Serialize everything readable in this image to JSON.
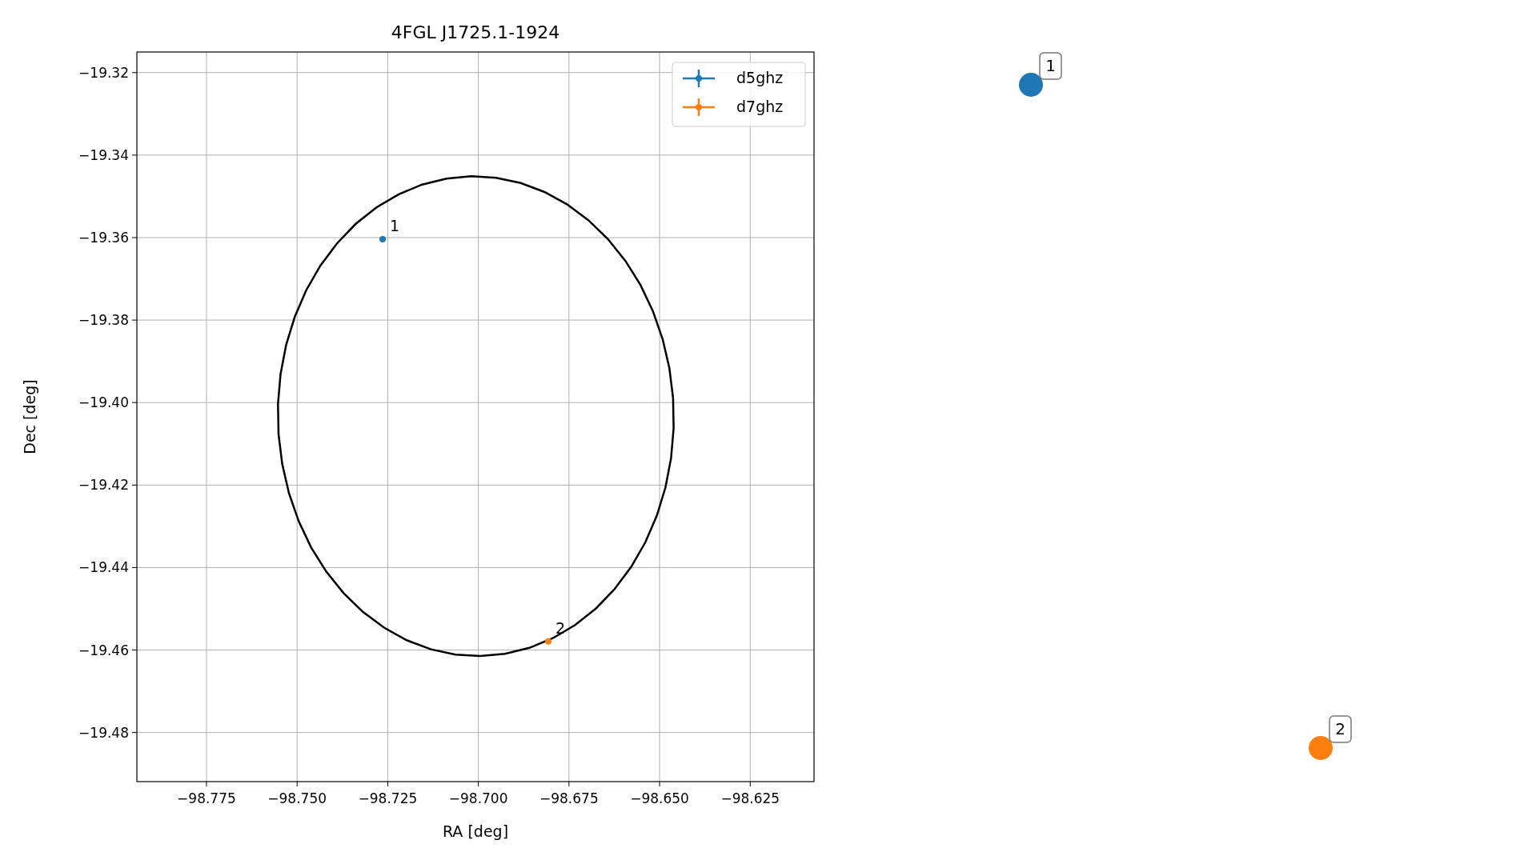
{
  "figure": {
    "chart_data": {
      "type": "scatter",
      "title": "4FGL J1725.1-1924",
      "xlabel": "RA [deg]",
      "ylabel": "Dec [deg]",
      "xlim": [
        -98.7942,
        -98.6074
      ],
      "ylim": [
        -19.4919,
        -19.315
      ],
      "xticks": [
        {
          "value": -98.775,
          "label": "−98.775"
        },
        {
          "value": -98.75,
          "label": "−98.750"
        },
        {
          "value": -98.725,
          "label": "−98.725"
        },
        {
          "value": -98.7,
          "label": "−98.700"
        },
        {
          "value": -98.675,
          "label": "−98.675"
        },
        {
          "value": -98.65,
          "label": "−98.650"
        },
        {
          "value": -98.625,
          "label": "−98.625"
        }
      ],
      "yticks": [
        {
          "value": -19.32,
          "label": "−19.32"
        },
        {
          "value": -19.34,
          "label": "−19.34"
        },
        {
          "value": -19.36,
          "label": "−19.36"
        },
        {
          "value": -19.38,
          "label": "−19.38"
        },
        {
          "value": -19.4,
          "label": "−19.40"
        },
        {
          "value": -19.42,
          "label": "−19.42"
        },
        {
          "value": -19.44,
          "label": "−19.44"
        },
        {
          "value": -19.46,
          "label": "−19.46"
        },
        {
          "value": -19.48,
          "label": "−19.48"
        }
      ],
      "series": [
        {
          "name": "d5ghz",
          "color": "#1f77b4",
          "x": [
            -98.7264
          ],
          "values": [
            -19.3604
          ]
        },
        {
          "name": "d7ghz",
          "color": "#ff7f0e",
          "x": [
            -98.6807
          ],
          "values": [
            -19.4579
          ]
        }
      ],
      "grid": true,
      "legend": true,
      "annotations": [
        {
          "x": -98.7264,
          "y": -19.3604,
          "text": "1"
        },
        {
          "x": -98.6807,
          "y": -19.4579,
          "text": "2"
        }
      ]
    },
    "side_markers": [
      {
        "label": "1",
        "color": "#1f77b4"
      },
      {
        "label": "2",
        "color": "#ff7f0e"
      }
    ]
  }
}
